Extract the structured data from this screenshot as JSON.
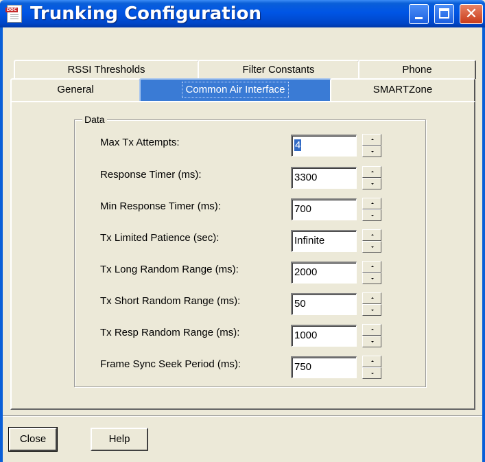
{
  "window": {
    "title": "Trunking Configuration",
    "icon": "doc-icon",
    "icon_tag": "DOC"
  },
  "tabs": {
    "row1": [
      "RSSI Thresholds",
      "Filter Constants",
      "Phone"
    ],
    "row2": [
      "General",
      "Common Air Interface",
      "SMARTZone"
    ],
    "active": "Common Air Interface",
    "active_color": "#3a7bd5"
  },
  "group": {
    "title": "Data"
  },
  "fields": [
    {
      "label": "Max Tx Attempts:",
      "value": "4",
      "selected": true
    },
    {
      "label": "Response Timer (ms):",
      "value": "3300"
    },
    {
      "label": "Min Response Timer (ms):",
      "value": "700"
    },
    {
      "label": "Tx Limited Patience (sec):",
      "value": "Infinite"
    },
    {
      "label": "Tx Long Random Range (ms):",
      "value": "2000"
    },
    {
      "label": "Tx Short Random Range (ms):",
      "value": "50"
    },
    {
      "label": "Tx Resp Random Range (ms):",
      "value": "1000"
    },
    {
      "label": "Frame Sync Seek Period (ms):",
      "value": "750"
    }
  ],
  "buttons": {
    "close": "Close",
    "help": "Help"
  },
  "colors": {
    "titlebar": "#0055e5",
    "close_button": "#c93b1a",
    "face": "#ece9d8"
  }
}
